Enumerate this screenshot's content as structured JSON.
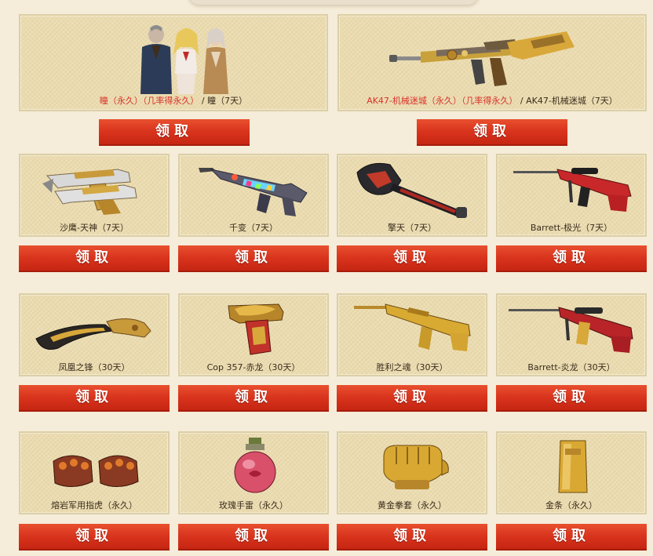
{
  "claim_label": "领取",
  "featured": [
    {
      "parts": [
        {
          "text": "瞳（永久）（几率得永久）",
          "color": "red"
        },
        {
          "text": " / ",
          "color": "dark"
        },
        {
          "text": "瞳（7天）",
          "color": "dark"
        }
      ],
      "art": "character-group"
    },
    {
      "parts": [
        {
          "text": "AK47-机械迷城（永久）（几率得永久）",
          "color": "red"
        },
        {
          "text": " / ",
          "color": "dark"
        },
        {
          "text": "AK47-机械迷城（7天）",
          "color": "dark"
        }
      ],
      "art": "rifle-gold"
    }
  ],
  "rows": [
    [
      {
        "name": "沙鹰-天神（7天）",
        "art": "dual-pistol-icon"
      },
      {
        "name": "千变（7天）",
        "art": "rifle-neon-icon"
      },
      {
        "name": "擎天（7天）",
        "art": "shovel-axe-icon"
      },
      {
        "name": "Barrett-极光（7天）",
        "art": "sniper-red-icon"
      }
    ],
    [
      {
        "name": "凤凰之锋（30天）",
        "art": "kukri-knife-icon"
      },
      {
        "name": "Cop 357-赤龙（30天）",
        "art": "dragon-pistol-icon"
      },
      {
        "name": "胜利之魂（30天）",
        "art": "gold-rifle-icon"
      },
      {
        "name": "Barrett-炎龙（30天）",
        "art": "sniper-dragon-icon"
      }
    ],
    [
      {
        "name": "熔岩军用指虎（永久）",
        "art": "knuckles-icon"
      },
      {
        "name": "玫瑰手雷（永久）",
        "art": "rose-grenade-icon"
      },
      {
        "name": "黄金拳套（永久）",
        "art": "gold-glove-icon"
      },
      {
        "name": "金条（永久）",
        "art": "gold-bar-icon"
      }
    ]
  ]
}
